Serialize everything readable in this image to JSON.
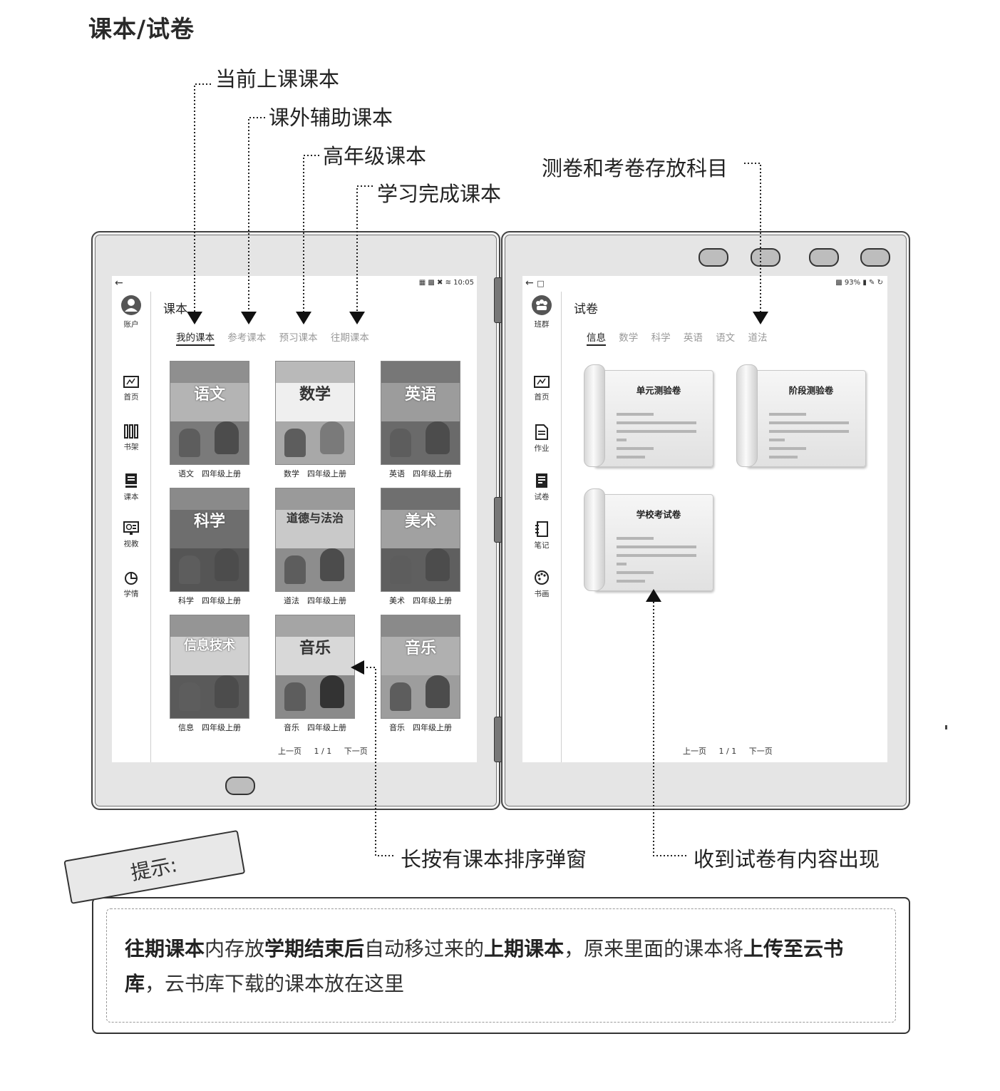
{
  "page_title": "课本/试卷",
  "callouts": {
    "current": "当前上课课本",
    "extra": "课外辅助课本",
    "higher": "高年级课本",
    "done": "学习完成课本",
    "subjects": "测卷和考卷存放科目",
    "longpress": "长按有课本排序弹窗",
    "received": "收到试卷有内容出现"
  },
  "left": {
    "status_time": "10:05",
    "sidebar_top": "账户",
    "nav": [
      "首页",
      "书架",
      "课本",
      "视教",
      "学情"
    ],
    "page_title": "课本",
    "tabs": [
      "我的课本",
      "参考课本",
      "预习课本",
      "往期课本"
    ],
    "books": [
      {
        "cover": "语文",
        "label": "语文　四年级上册"
      },
      {
        "cover": "数学",
        "label": "数学　四年级上册"
      },
      {
        "cover": "英语",
        "label": "英语　四年级上册"
      },
      {
        "cover": "科学",
        "label": "科学　四年级上册"
      },
      {
        "cover": "道德与法治",
        "label": "道法　四年级上册"
      },
      {
        "cover": "美术",
        "label": "美术　四年级上册"
      },
      {
        "cover": "信息技术",
        "label": "信息　四年级上册"
      },
      {
        "cover": "音乐",
        "label": "音乐　四年级上册"
      },
      {
        "cover": "音乐",
        "label": "音乐　四年级上册"
      }
    ],
    "pager": {
      "prev": "上一页",
      "page": "1 / 1",
      "next": "下一页"
    }
  },
  "right": {
    "status_battery": "93%",
    "sidebar_top": "班群",
    "nav": [
      "首页",
      "作业",
      "试卷",
      "笔记",
      "书画"
    ],
    "page_title": "试卷",
    "tabs": [
      "信息",
      "数学",
      "科学",
      "英语",
      "语文",
      "道法"
    ],
    "folders": [
      "单元测验卷",
      "阶段测验卷",
      "学校考试卷"
    ],
    "pager": {
      "prev": "上一页",
      "page": "1 / 1",
      "next": "下一页"
    }
  },
  "hint": {
    "tab": "提示:",
    "b1": "往期课本",
    "t1": "内存放",
    "b2": "学期结束后",
    "t2": "自动移过来的",
    "b3": "上期课本",
    "t3": "，原来里面的课本将",
    "b4": "上传至云书库",
    "t4": "，云书库下载的课本放在这里"
  }
}
